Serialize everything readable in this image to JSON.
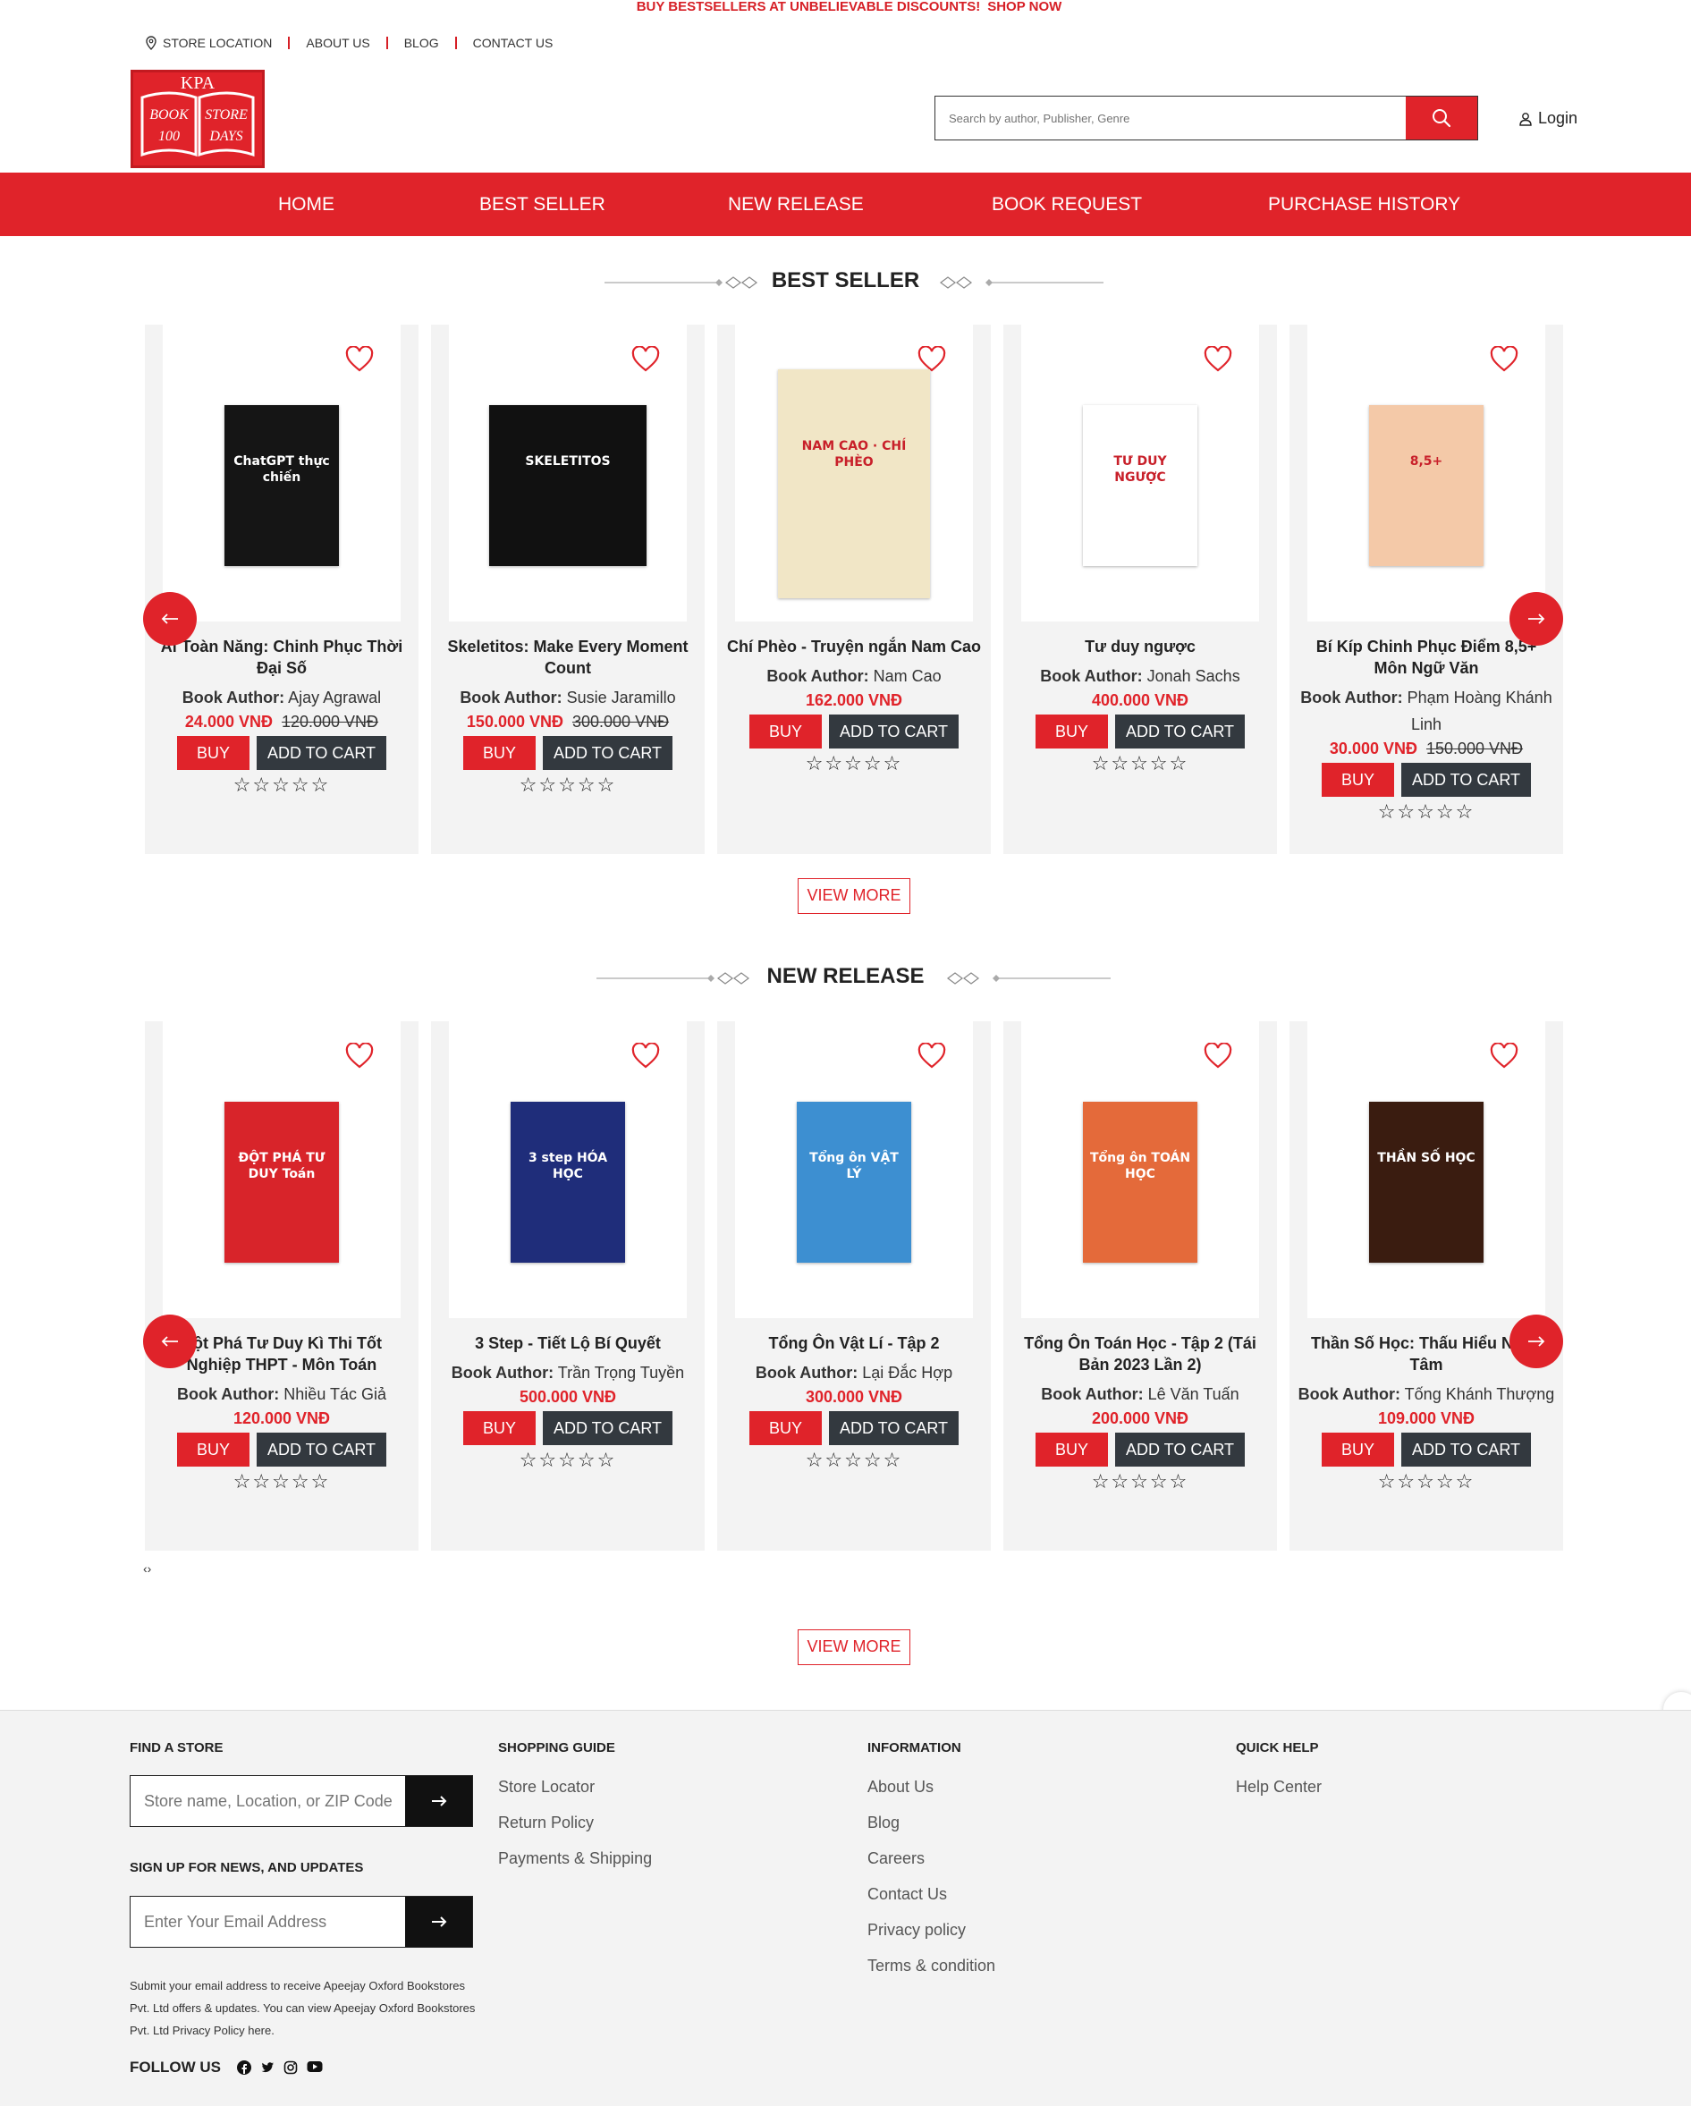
{
  "promo": {
    "text": "BUY BESTSELLERS AT UNBELIEVABLE DISCOUNTS!",
    "cta": "SHOP NOW"
  },
  "top_links": [
    "STORE LOCATION",
    "ABOUT US",
    "BLOG",
    "CONTACT US"
  ],
  "logo": {
    "top": "KPA",
    "left_top": "BOOK",
    "left_bottom": "100",
    "right_top": "STORE",
    "right_bottom": "DAYS"
  },
  "search": {
    "placeholder": "Search by author, Publisher, Genre"
  },
  "login": "Login",
  "nav": [
    "HOME",
    "BEST SELLER",
    "NEW RELEASE",
    "BOOK REQUEST",
    "PURCHASE HISTORY"
  ],
  "best_seller": {
    "title": "BEST SELLER",
    "view_more": "VIEW MORE",
    "items": [
      {
        "title": "Ai Toàn Năng: Chinh Phục Thời Đại Số",
        "author_label": "Book Author:",
        "author": "Ajay Agrawal",
        "price": "24.000 VNĐ",
        "old_price": "120.000 VNĐ",
        "cover_color": "#151515",
        "cover_text": "ChatGPT thực chiến"
      },
      {
        "title": "Skeletitos: Make Every Moment Count",
        "author_label": "Book Author:",
        "author": "Susie Jaramillo",
        "price": "150.000 VNĐ",
        "old_price": "300.000 VNĐ",
        "cover_color": "#111111",
        "cover_text": "SKELETITOS"
      },
      {
        "title": "Chí Phèo - Truyện ngắn Nam Cao",
        "author_label": "Book Author:",
        "author": "Nam Cao",
        "price": "162.000 VNĐ",
        "old_price": "",
        "cover_color": "#f1e6c6",
        "cover_text": "NAM CAO · CHÍ PHÈO"
      },
      {
        "title": "Tư duy ngược",
        "author_label": "Book Author:",
        "author": "Jonah Sachs",
        "price": "400.000 VNĐ",
        "old_price": "",
        "cover_color": "#ffffff",
        "cover_text": "TƯ DUY NGƯỢC"
      },
      {
        "title": "Bí Kíp Chinh Phục Điểm 8,5+ Môn Ngữ Văn",
        "author_label": "Book Author:",
        "author": "Phạm Hoàng Khánh Linh",
        "price": "30.000 VNĐ",
        "old_price": "150.000 VNĐ",
        "cover_color": "#f4c9a8",
        "cover_text": "8,5+"
      }
    ]
  },
  "new_release": {
    "title": "NEW RELEASE",
    "view_more": "VIEW MORE",
    "items": [
      {
        "title": "Đột Phá Tư Duy Kì Thi Tốt Nghiệp THPT - Môn Toán",
        "author_label": "Book Author:",
        "author": "Nhiều Tác Giả",
        "price": "120.000 VNĐ",
        "old_price": "",
        "cover_color": "#d8242a",
        "cover_text": "ĐỘT PHÁ TƯ DUY Toán"
      },
      {
        "title": "3 Step - Tiết Lộ Bí Quyết",
        "author_label": "Book Author:",
        "author": "Trần Trọng Tuyền",
        "price": "500.000 VNĐ",
        "old_price": "",
        "cover_color": "#1f2d7a",
        "cover_text": "3 step HÓA HỌC"
      },
      {
        "title": "Tổng Ôn Vật Lí - Tập 2",
        "author_label": "Book Author:",
        "author": "Lại Đắc Hợp",
        "price": "300.000 VNĐ",
        "old_price": "",
        "cover_color": "#3d8fd1",
        "cover_text": "Tổng ôn VẬT LÝ"
      },
      {
        "title": "Tổng Ôn Toán Học - Tập 2 (Tái Bản 2023 Lần 2)",
        "author_label": "Book Author:",
        "author": "Lê Văn Tuấn",
        "price": "200.000 VNĐ",
        "old_price": "",
        "cover_color": "#e46a3a",
        "cover_text": "Tổng ôn TOÁN HỌC"
      },
      {
        "title": "Thần Số Học: Thấu Hiểu Nhân Tâm",
        "author_label": "Book Author:",
        "author": "Tống Khánh Thượng",
        "price": "109.000 VNĐ",
        "old_price": "",
        "cover_color": "#3a1c10",
        "cover_text": "THẦN SỐ HỌC"
      }
    ]
  },
  "buttons": {
    "buy": "BUY",
    "add_to_cart": "ADD TO CART"
  },
  "stars": "☆☆☆☆☆",
  "carousel_ctrl": "‹›",
  "footer": {
    "find_store": {
      "heading": "FIND A STORE",
      "placeholder": "Store name, Location, or ZIP Code"
    },
    "signup": {
      "heading": "SIGN UP FOR NEWS, AND UPDATES",
      "placeholder": "Enter Your Email Address"
    },
    "note": "Submit your email address to receive Apeejay Oxford Bookstores Pvt. Ltd offers & updates. You can view Apeejay Oxford Bookstores Pvt. Ltd Privacy Policy here.",
    "follow": "FOLLOW US",
    "shopping_guide": {
      "heading": "SHOPPING GUIDE",
      "links": [
        "Store Locator",
        "Return Policy",
        "Payments & Shipping"
      ]
    },
    "information": {
      "heading": "INFORMATION",
      "links": [
        "About Us",
        "Blog",
        "Careers",
        "Contact Us",
        "Privacy policy",
        "Terms & condition"
      ]
    },
    "quick_help": {
      "heading": "QUICK HELP",
      "links": [
        "Help Center"
      ]
    }
  }
}
